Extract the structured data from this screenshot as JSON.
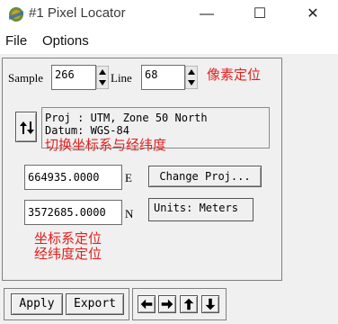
{
  "window": {
    "title": "#1 Pixel Locator",
    "minimize_glyph": "—",
    "maximize_glyph": "☐",
    "close_glyph": "✕"
  },
  "menu": {
    "items": [
      "File",
      "Options"
    ]
  },
  "coords": {
    "sample_label": "Sample",
    "sample_value": "266",
    "line_label": "Line",
    "line_value": "68"
  },
  "projection": {
    "line1": "Proj : UTM, Zone 50 North",
    "line2": "Datum: WGS-84"
  },
  "map_coords": {
    "easting_value": "664935.0000",
    "easting_label": "E",
    "northing_value": "3572685.0000",
    "northing_label": "N",
    "change_proj_label": "Change Proj...",
    "units_label": "Units: Meters"
  },
  "annotations": {
    "pixel_locate": "像素定位",
    "switch_system": "切换坐标系与经纬度",
    "coord_locate": "坐标系定位",
    "latlon_locate": "经纬度定位"
  },
  "buttons": {
    "apply": "Apply",
    "export": "Export"
  },
  "icons": {
    "app": "pixel-locator-app-icon",
    "swap": "swap-arrows-icon",
    "nav": [
      "arrow-left-icon",
      "arrow-right-icon",
      "arrow-up-icon",
      "arrow-down-icon"
    ]
  },
  "colors": {
    "annotation": "#e02020"
  }
}
